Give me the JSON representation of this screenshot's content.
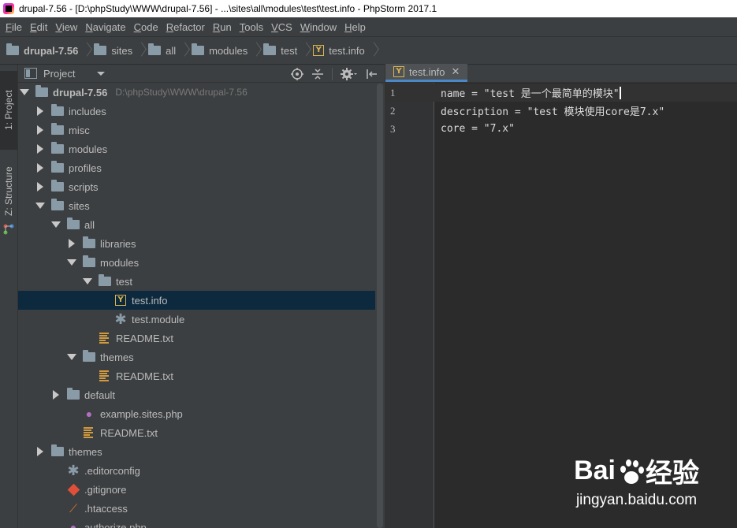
{
  "window": {
    "title": "drupal-7.56 - [D:\\phpStudy\\WWW\\drupal-7.56] - ...\\sites\\all\\modules\\test\\test.info - PhpStorm 2017.1"
  },
  "menu": {
    "items": [
      {
        "u": "F",
        "rest": "ile"
      },
      {
        "u": "E",
        "rest": "dit"
      },
      {
        "u": "V",
        "rest": "iew"
      },
      {
        "u": "N",
        "rest": "avigate"
      },
      {
        "u": "C",
        "rest": "ode"
      },
      {
        "u": "R",
        "rest": "efactor"
      },
      {
        "u": "R",
        "rest": "un"
      },
      {
        "u": "T",
        "rest": "ools"
      },
      {
        "u": "V",
        "rest": "CS"
      },
      {
        "u": "W",
        "rest": "indow"
      },
      {
        "u": "H",
        "rest": "elp"
      }
    ]
  },
  "breadcrumb": {
    "items": [
      "drupal-7.56",
      "sites",
      "all",
      "modules",
      "test",
      "test.info"
    ]
  },
  "stripe": {
    "project_tab": "1: Project",
    "structure_tab": "Z: Structure"
  },
  "project_panel": {
    "title": "Project",
    "root_path": "D:\\phpStudy\\WWW\\drupal-7.56",
    "tree": [
      {
        "label": "drupal-7.56",
        "depth": 0,
        "arrow": "down",
        "icon": "folder",
        "bold": true
      },
      {
        "label": "includes",
        "depth": 1,
        "arrow": "right",
        "icon": "folder"
      },
      {
        "label": "misc",
        "depth": 1,
        "arrow": "right",
        "icon": "folder"
      },
      {
        "label": "modules",
        "depth": 1,
        "arrow": "right",
        "icon": "folder"
      },
      {
        "label": "profiles",
        "depth": 1,
        "arrow": "right",
        "icon": "folder"
      },
      {
        "label": "scripts",
        "depth": 1,
        "arrow": "right",
        "icon": "folder"
      },
      {
        "label": "sites",
        "depth": 1,
        "arrow": "down",
        "icon": "folder"
      },
      {
        "label": "all",
        "depth": 2,
        "arrow": "down",
        "icon": "folder"
      },
      {
        "label": "libraries",
        "depth": 3,
        "arrow": "right",
        "icon": "folder"
      },
      {
        "label": "modules",
        "depth": 3,
        "arrow": "down",
        "icon": "folder"
      },
      {
        "label": "test",
        "depth": 4,
        "arrow": "down",
        "icon": "folder"
      },
      {
        "label": "test.info",
        "depth": 5,
        "arrow": "none",
        "icon": "info",
        "selected": true
      },
      {
        "label": "test.module",
        "depth": 5,
        "arrow": "none",
        "icon": "star"
      },
      {
        "label": "README.txt",
        "depth": 4,
        "arrow": "none",
        "icon": "txt"
      },
      {
        "label": "themes",
        "depth": 3,
        "arrow": "down",
        "icon": "folder"
      },
      {
        "label": "README.txt",
        "depth": 4,
        "arrow": "none",
        "icon": "txt"
      },
      {
        "label": "default",
        "depth": 2,
        "arrow": "right",
        "icon": "folder"
      },
      {
        "label": "example.sites.php",
        "depth": 3,
        "arrow": "none",
        "icon": "php"
      },
      {
        "label": "README.txt",
        "depth": 3,
        "arrow": "none",
        "icon": "txt"
      },
      {
        "label": "themes",
        "depth": 1,
        "arrow": "right",
        "icon": "folder"
      },
      {
        "label": ".editorconfig",
        "depth": 2,
        "arrow": "none",
        "icon": "star"
      },
      {
        "label": ".gitignore",
        "depth": 2,
        "arrow": "none",
        "icon": "git"
      },
      {
        "label": ".htaccess",
        "depth": 2,
        "arrow": "none",
        "icon": "ht"
      },
      {
        "label": "authorize.php",
        "depth": 2,
        "arrow": "none",
        "icon": "php"
      }
    ]
  },
  "editor": {
    "tab_label": "test.info",
    "lines": [
      {
        "num": "1",
        "text": "name = \"test 是一个最简单的模块\""
      },
      {
        "num": "2",
        "text": "description = \"test 模块使用core是7.x\""
      },
      {
        "num": "3",
        "text": "core = \"7.x\""
      }
    ]
  },
  "watermark": {
    "brand_left": "Bai",
    "brand_right": "经验",
    "url": "jingyan.baidu.com"
  },
  "colors": {
    "background": "#2b2b2b",
    "panel": "#3c3f41",
    "selection": "#0d293e",
    "tab_accent": "#4a88c7"
  }
}
